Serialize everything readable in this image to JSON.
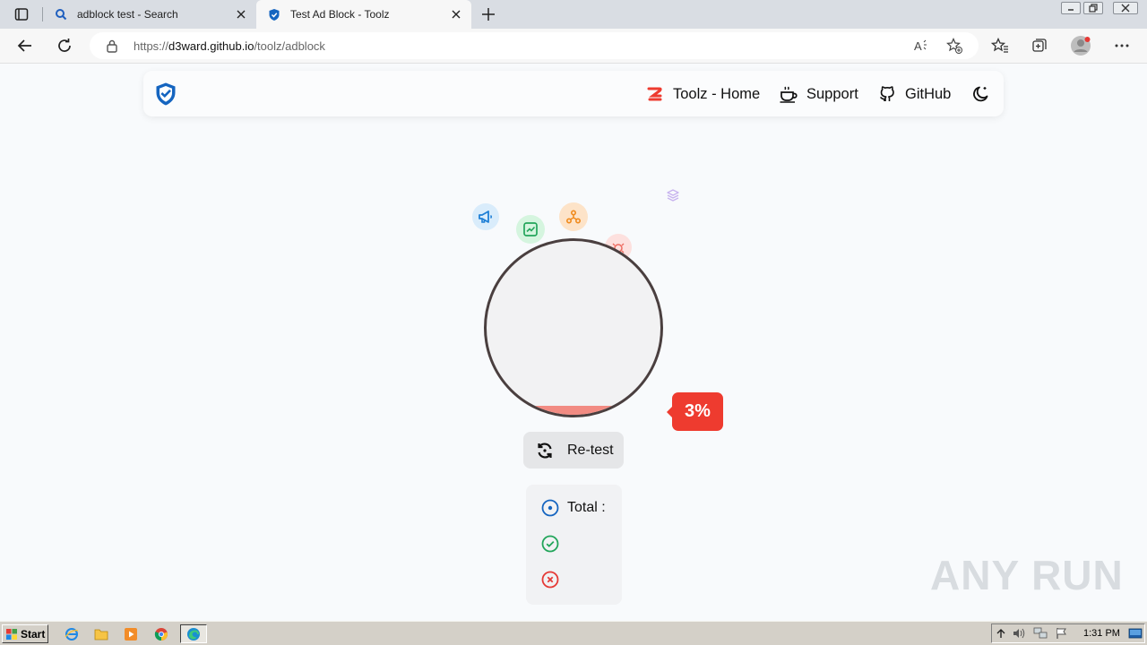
{
  "browser": {
    "tabs": [
      {
        "title": "adblock test - Search",
        "active": false
      },
      {
        "title": "Test Ad Block - Toolz",
        "active": true
      }
    ],
    "url_prefix": "https://",
    "url_host": "d3ward.github.io",
    "url_path": "/toolz/adblock"
  },
  "nav": {
    "items": [
      {
        "label": "Toolz - Home",
        "icon": "toolz-logo-icon"
      },
      {
        "label": "Support",
        "icon": "coffee-cup-icon"
      },
      {
        "label": "GitHub",
        "icon": "github-icon"
      }
    ],
    "theme_toggle_icon": "moon-icon"
  },
  "test": {
    "percentage": "3%",
    "progress_value": 0.03,
    "retest_label": "Re-test",
    "stats": {
      "total_label": "Total :"
    }
  },
  "watermark": "ANY RUN",
  "taskbar": {
    "start_label": "Start",
    "clock": "1:31 PM"
  },
  "colors": {
    "accent_red": "#ee3b2f",
    "fill_red": "#f28b82",
    "logo_blue": "#1565c0",
    "ok_green": "#22a55a",
    "error_red": "#e53935"
  }
}
